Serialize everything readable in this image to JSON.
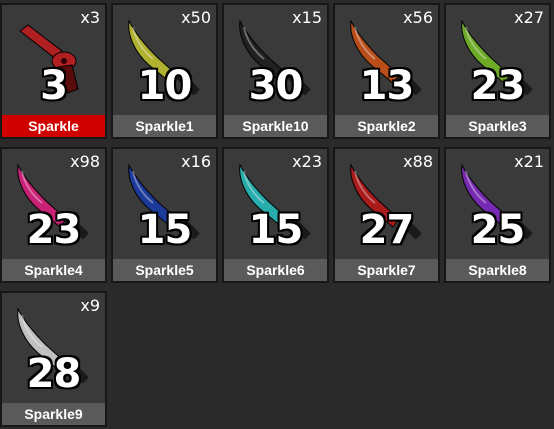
{
  "inventory": {
    "items": [
      {
        "name": "Sparkle",
        "count": "x3",
        "value": "3",
        "kind": "gun",
        "color": "#b02020",
        "selected": true
      },
      {
        "name": "Sparkle1",
        "count": "x50",
        "value": "10",
        "kind": "knife",
        "color": "#b8b830"
      },
      {
        "name": "Sparkle10",
        "count": "x15",
        "value": "30",
        "kind": "knife",
        "color": "#202020"
      },
      {
        "name": "Sparkle2",
        "count": "x56",
        "value": "13",
        "kind": "knife",
        "color": "#c0501a"
      },
      {
        "name": "Sparkle3",
        "count": "x27",
        "value": "23",
        "kind": "knife",
        "color": "#6fb028"
      },
      {
        "name": "Sparkle4",
        "count": "x98",
        "value": "23",
        "kind": "knife",
        "color": "#d0207a"
      },
      {
        "name": "Sparkle5",
        "count": "x16",
        "value": "15",
        "kind": "knife",
        "color": "#1a3aa0"
      },
      {
        "name": "Sparkle6",
        "count": "x23",
        "value": "15",
        "kind": "knife",
        "color": "#28b4b4"
      },
      {
        "name": "Sparkle7",
        "count": "x88",
        "value": "27",
        "kind": "knife",
        "color": "#b01a1a"
      },
      {
        "name": "Sparkle8",
        "count": "x21",
        "value": "25",
        "kind": "knife",
        "color": "#7a2ab8"
      },
      {
        "name": "Sparkle9",
        "count": "x9",
        "value": "28",
        "kind": "knife",
        "color": "#c8c8c8"
      }
    ]
  }
}
